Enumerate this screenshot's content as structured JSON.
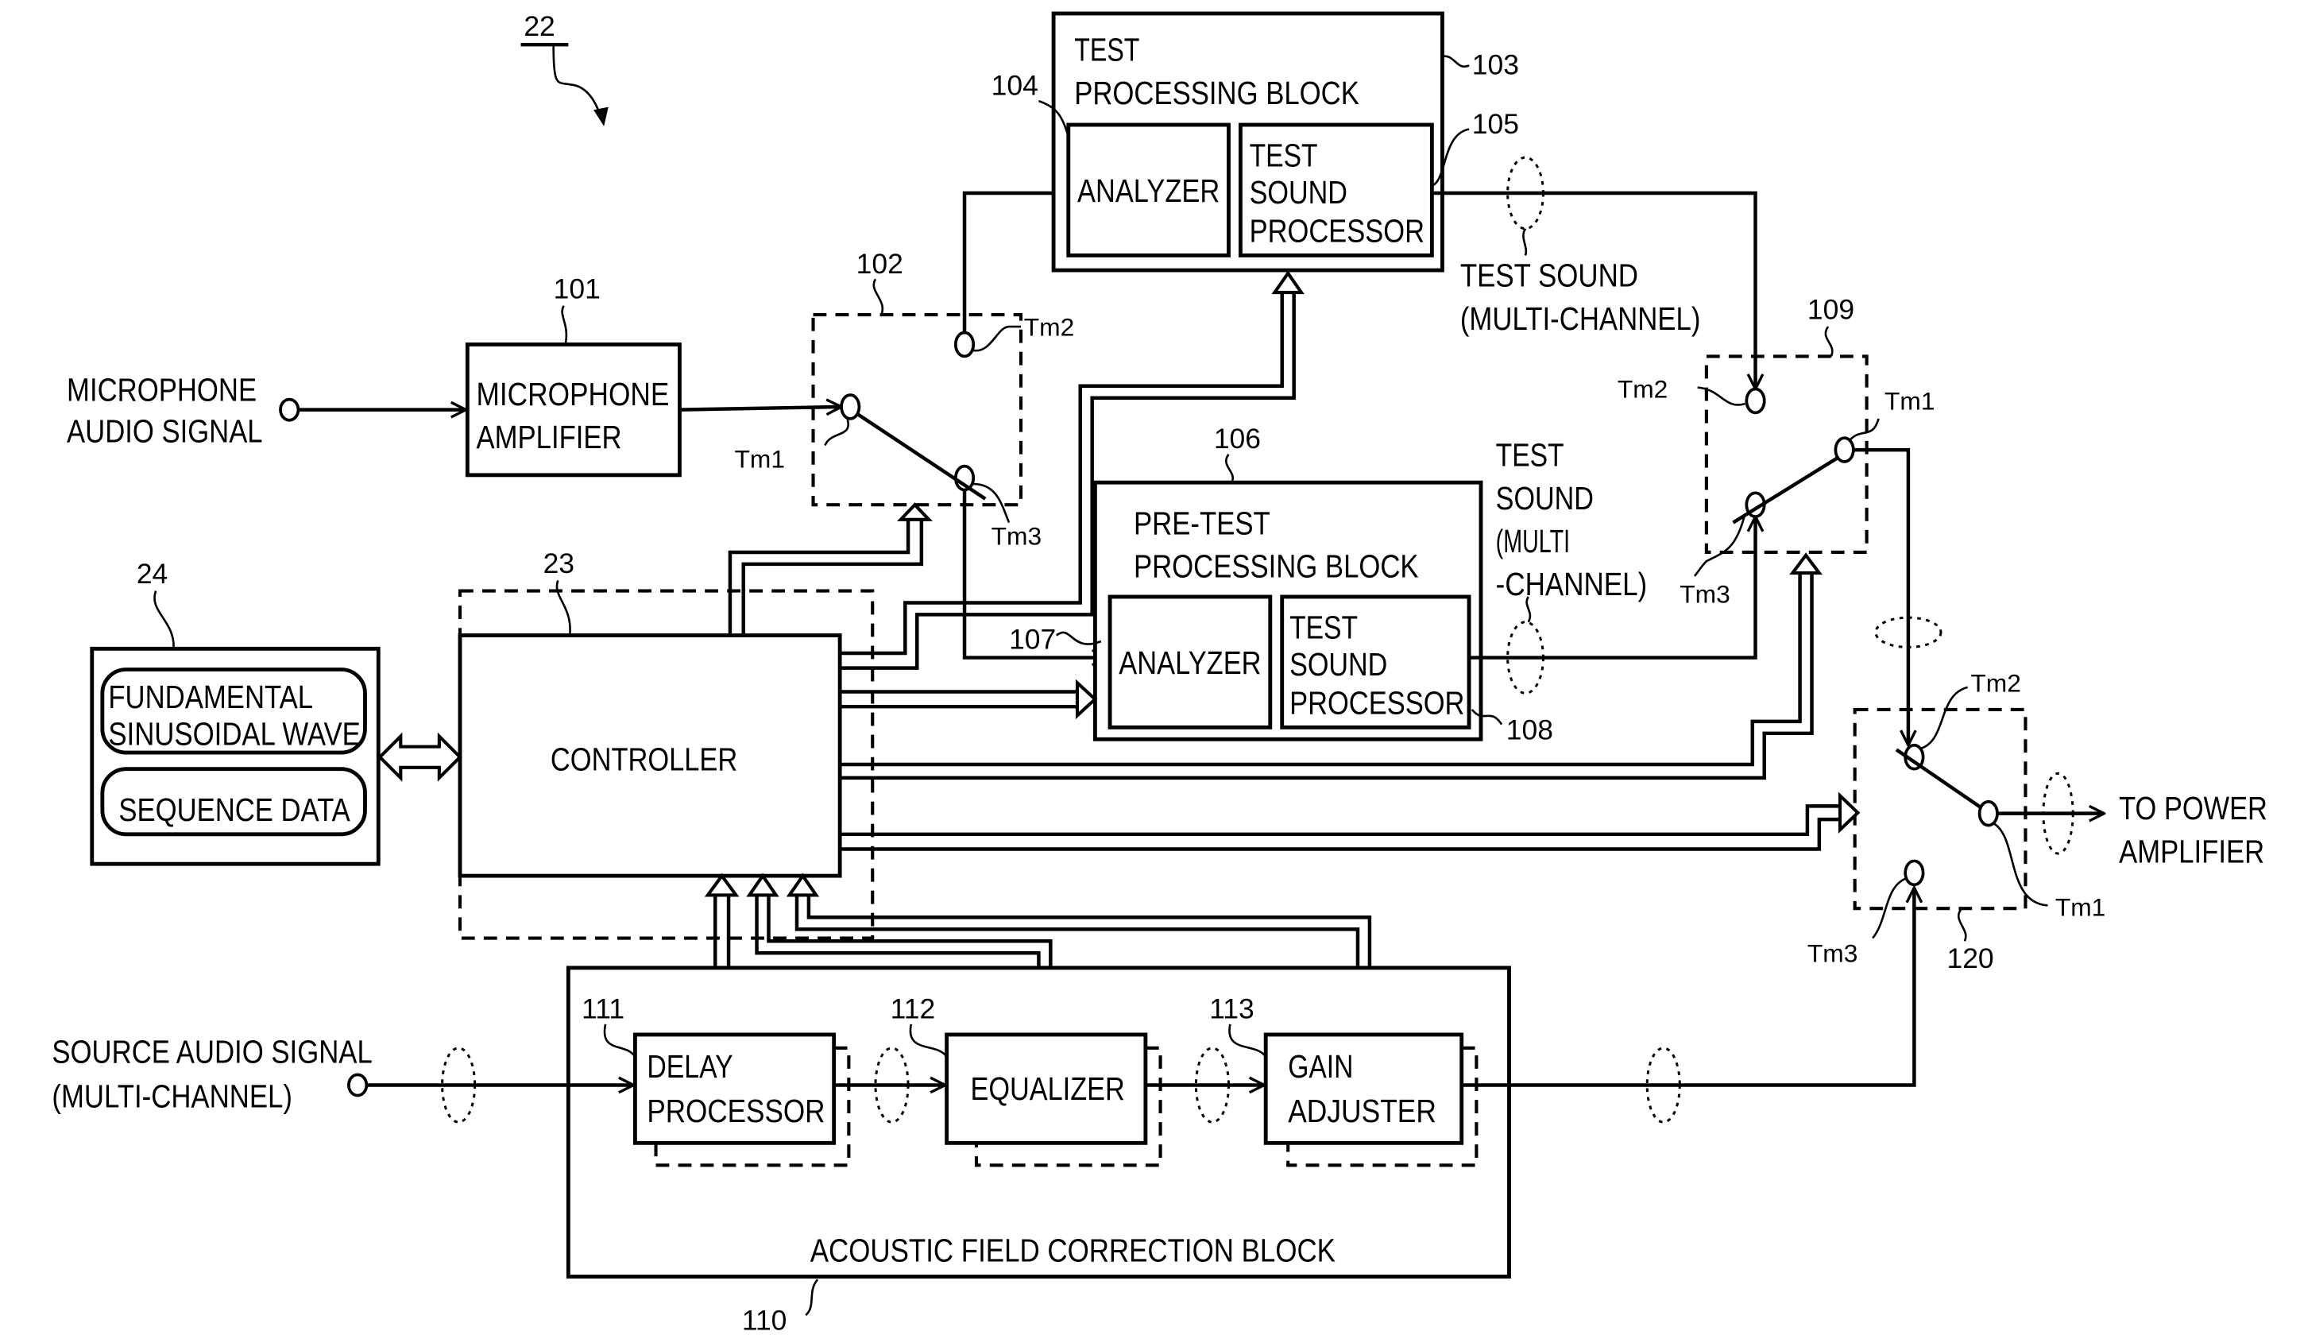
{
  "figure_ref": "22",
  "inputs": {
    "microphone": [
      "MICROPHONE",
      "AUDIO SIGNAL"
    ],
    "source": [
      "SOURCE AUDIO SIGNAL",
      "(MULTI-CHANNEL)"
    ]
  },
  "output_label": [
    "TO POWER",
    "AMPLIFIER"
  ],
  "blocks": {
    "mic_amp": {
      "ref": "101",
      "lines": [
        "MICROPHONE",
        "AMPLIFIER"
      ]
    },
    "switch_102": {
      "ref": "102"
    },
    "test_block": {
      "ref": "103",
      "lines": [
        "TEST",
        "PROCESSING BLOCK"
      ]
    },
    "test_analyzer": {
      "ref": "104",
      "label": "ANALYZER"
    },
    "test_sound_proc": {
      "ref": "105",
      "lines": [
        "TEST",
        "SOUND",
        "PROCESSOR"
      ]
    },
    "pretest_block": {
      "ref": "106",
      "lines": [
        "PRE-TEST",
        "PROCESSING BLOCK"
      ]
    },
    "pretest_analyzer": {
      "ref": "107",
      "label": "ANALYZER"
    },
    "pretest_sound_proc": {
      "ref": "108",
      "lines": [
        "TEST",
        "SOUND",
        "PROCESSOR"
      ]
    },
    "switch_109": {
      "ref": "109"
    },
    "acoustic_block": {
      "ref": "110",
      "label": "ACOUSTIC FIELD CORRECTION BLOCK"
    },
    "delay": {
      "ref": "111",
      "lines": [
        "DELAY",
        "PROCESSOR"
      ]
    },
    "equalizer": {
      "ref": "112",
      "label": "EQUALIZER"
    },
    "gain": {
      "ref": "113",
      "lines": [
        "GAIN",
        "ADJUSTER"
      ]
    },
    "switch_120": {
      "ref": "120"
    },
    "controller": {
      "ref": "23",
      "label": "CONTROLLER"
    },
    "memory": {
      "ref": "24",
      "items": [
        [
          "FUNDAMENTAL",
          "SINUSOIDAL WAVE"
        ],
        [
          "SEQUENCE DATA"
        ]
      ]
    }
  },
  "annotations": {
    "test_sound_mc": [
      "TEST SOUND",
      "(MULTI-CHANNEL)"
    ],
    "pretest_sound_mc": [
      "TEST",
      "SOUND",
      "(MULTI",
      "-CHANNEL)"
    ]
  },
  "terminals": {
    "tm1": "Tm1",
    "tm2": "Tm2",
    "tm3": "Tm3"
  }
}
